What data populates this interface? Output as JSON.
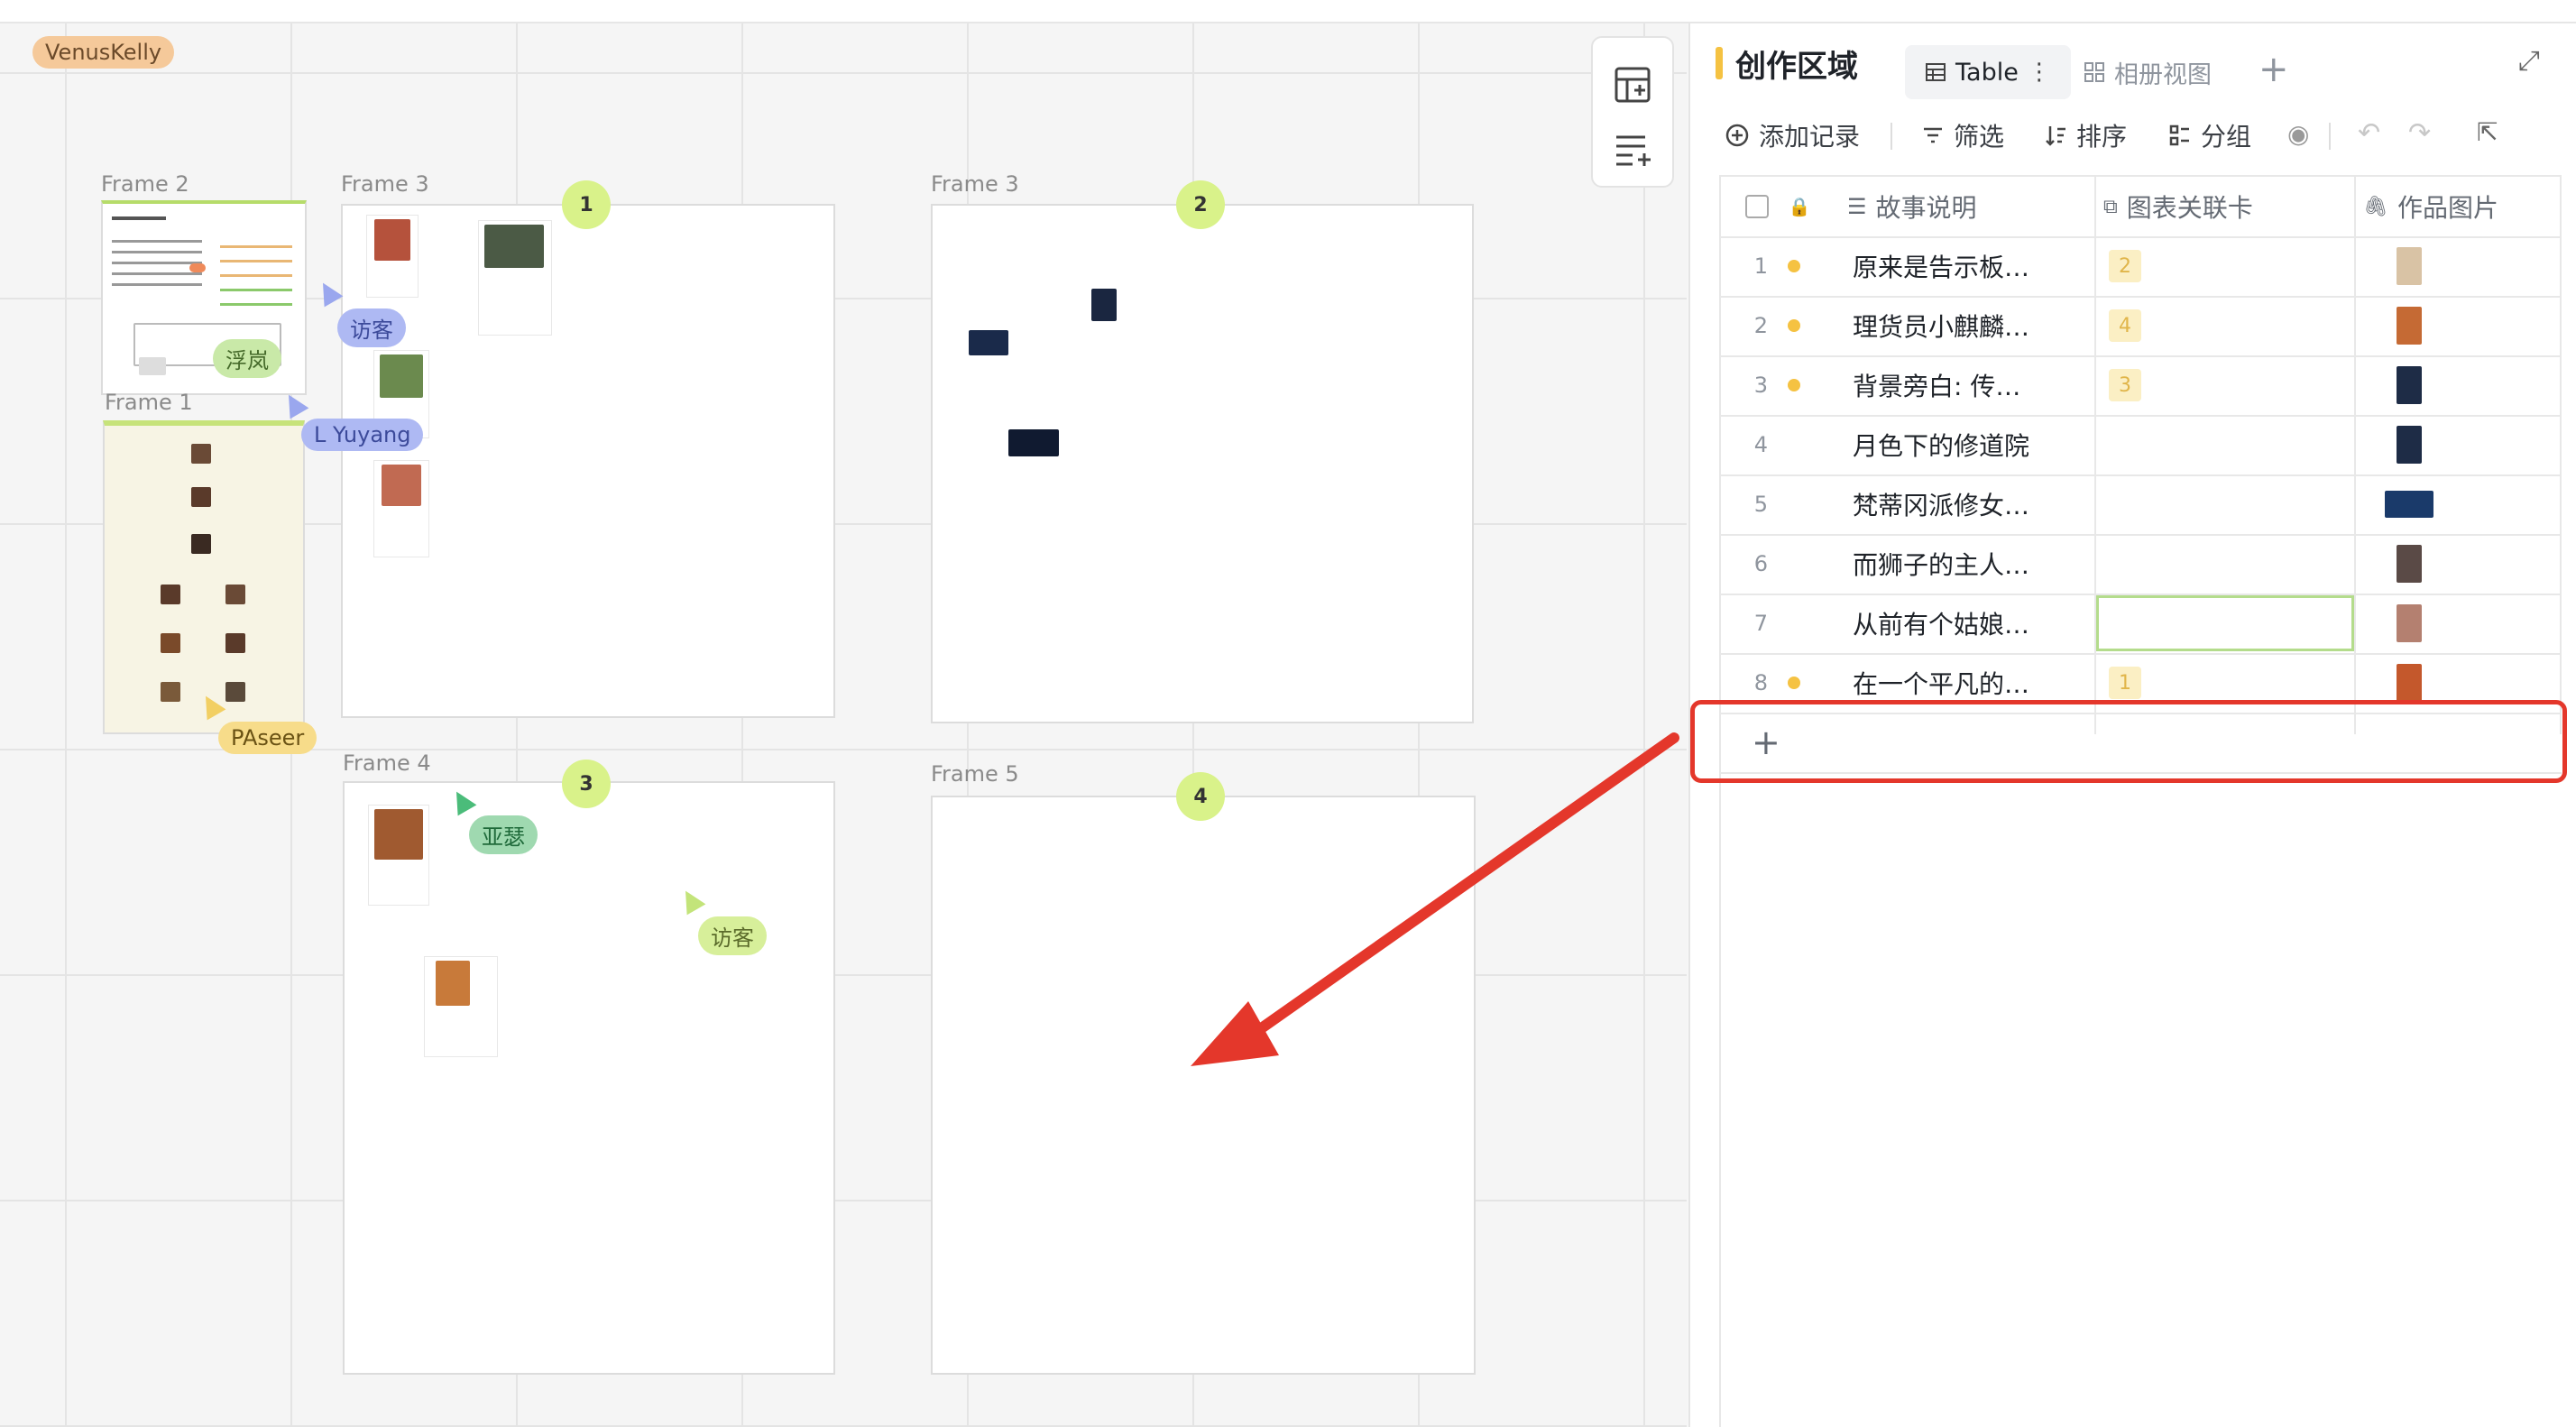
{
  "canvas": {
    "top_user_label": "VenusKelly",
    "frames": [
      {
        "label": "Frame 2"
      },
      {
        "label": "Frame 3"
      },
      {
        "label": "Frame 1"
      },
      {
        "label": "Frame 3"
      },
      {
        "label": "Frame 4"
      },
      {
        "label": "Frame 5"
      }
    ],
    "badges": [
      "1",
      "2",
      "3",
      "4"
    ],
    "cursors": [
      {
        "name": "访客",
        "color": "#aeb9f3"
      },
      {
        "name": "浮岚",
        "color": "#c9e9a8"
      },
      {
        "name": "L Yuyang",
        "color": "#aeb9f3"
      },
      {
        "name": "PAseer",
        "color": "#f7dc8a"
      },
      {
        "name": "亚瑟",
        "color": "#9fd9b0"
      },
      {
        "name": "访客",
        "color": "#d7ef9a"
      }
    ]
  },
  "toolbar": {
    "icons": [
      "table-insert-icon",
      "add-row-icon"
    ]
  },
  "panel": {
    "title": "创作区域",
    "tabs": [
      {
        "label": "Table",
        "icon": "table-icon"
      },
      {
        "label": "相册视图",
        "icon": "gallery-icon"
      }
    ],
    "actions": {
      "add_record": "添加记录",
      "filter": "筛选",
      "sort": "排序",
      "group": "分组"
    },
    "columns": [
      {
        "label": "故事说明",
        "icon": "text-field-icon"
      },
      {
        "label": "图表关联卡",
        "icon": "link-field-icon"
      },
      {
        "label": "作品图片",
        "icon": "attachment-icon"
      }
    ],
    "rows": [
      {
        "num": "1",
        "dot": true,
        "story": "原来是告示板…",
        "link": "2",
        "img": "panda"
      },
      {
        "num": "2",
        "dot": true,
        "story": "理货员小麒麟…",
        "link": "4",
        "img": "market"
      },
      {
        "num": "3",
        "dot": true,
        "story": "背景旁白: 传…",
        "link": "3",
        "img": "night"
      },
      {
        "num": "4",
        "dot": false,
        "story": "月色下的修道院",
        "link": "",
        "img": "night"
      },
      {
        "num": "5",
        "dot": false,
        "story": "梵蒂冈派修女…",
        "link": "",
        "img": "blue"
      },
      {
        "num": "6",
        "dot": false,
        "story": "而狮子的主人…",
        "link": "",
        "img": "dark"
      },
      {
        "num": "7",
        "dot": false,
        "story": "从前有个姑娘…",
        "link": "",
        "img": "warm"
      },
      {
        "num": "8",
        "dot": true,
        "story": "在一个平凡的…",
        "link": "1",
        "img": "fire"
      }
    ],
    "add_row_symbol": "+"
  },
  "colors": {
    "accent_yellow": "#f5c242",
    "highlight_red": "#e4372b",
    "badge_green": "#d9f28a"
  }
}
